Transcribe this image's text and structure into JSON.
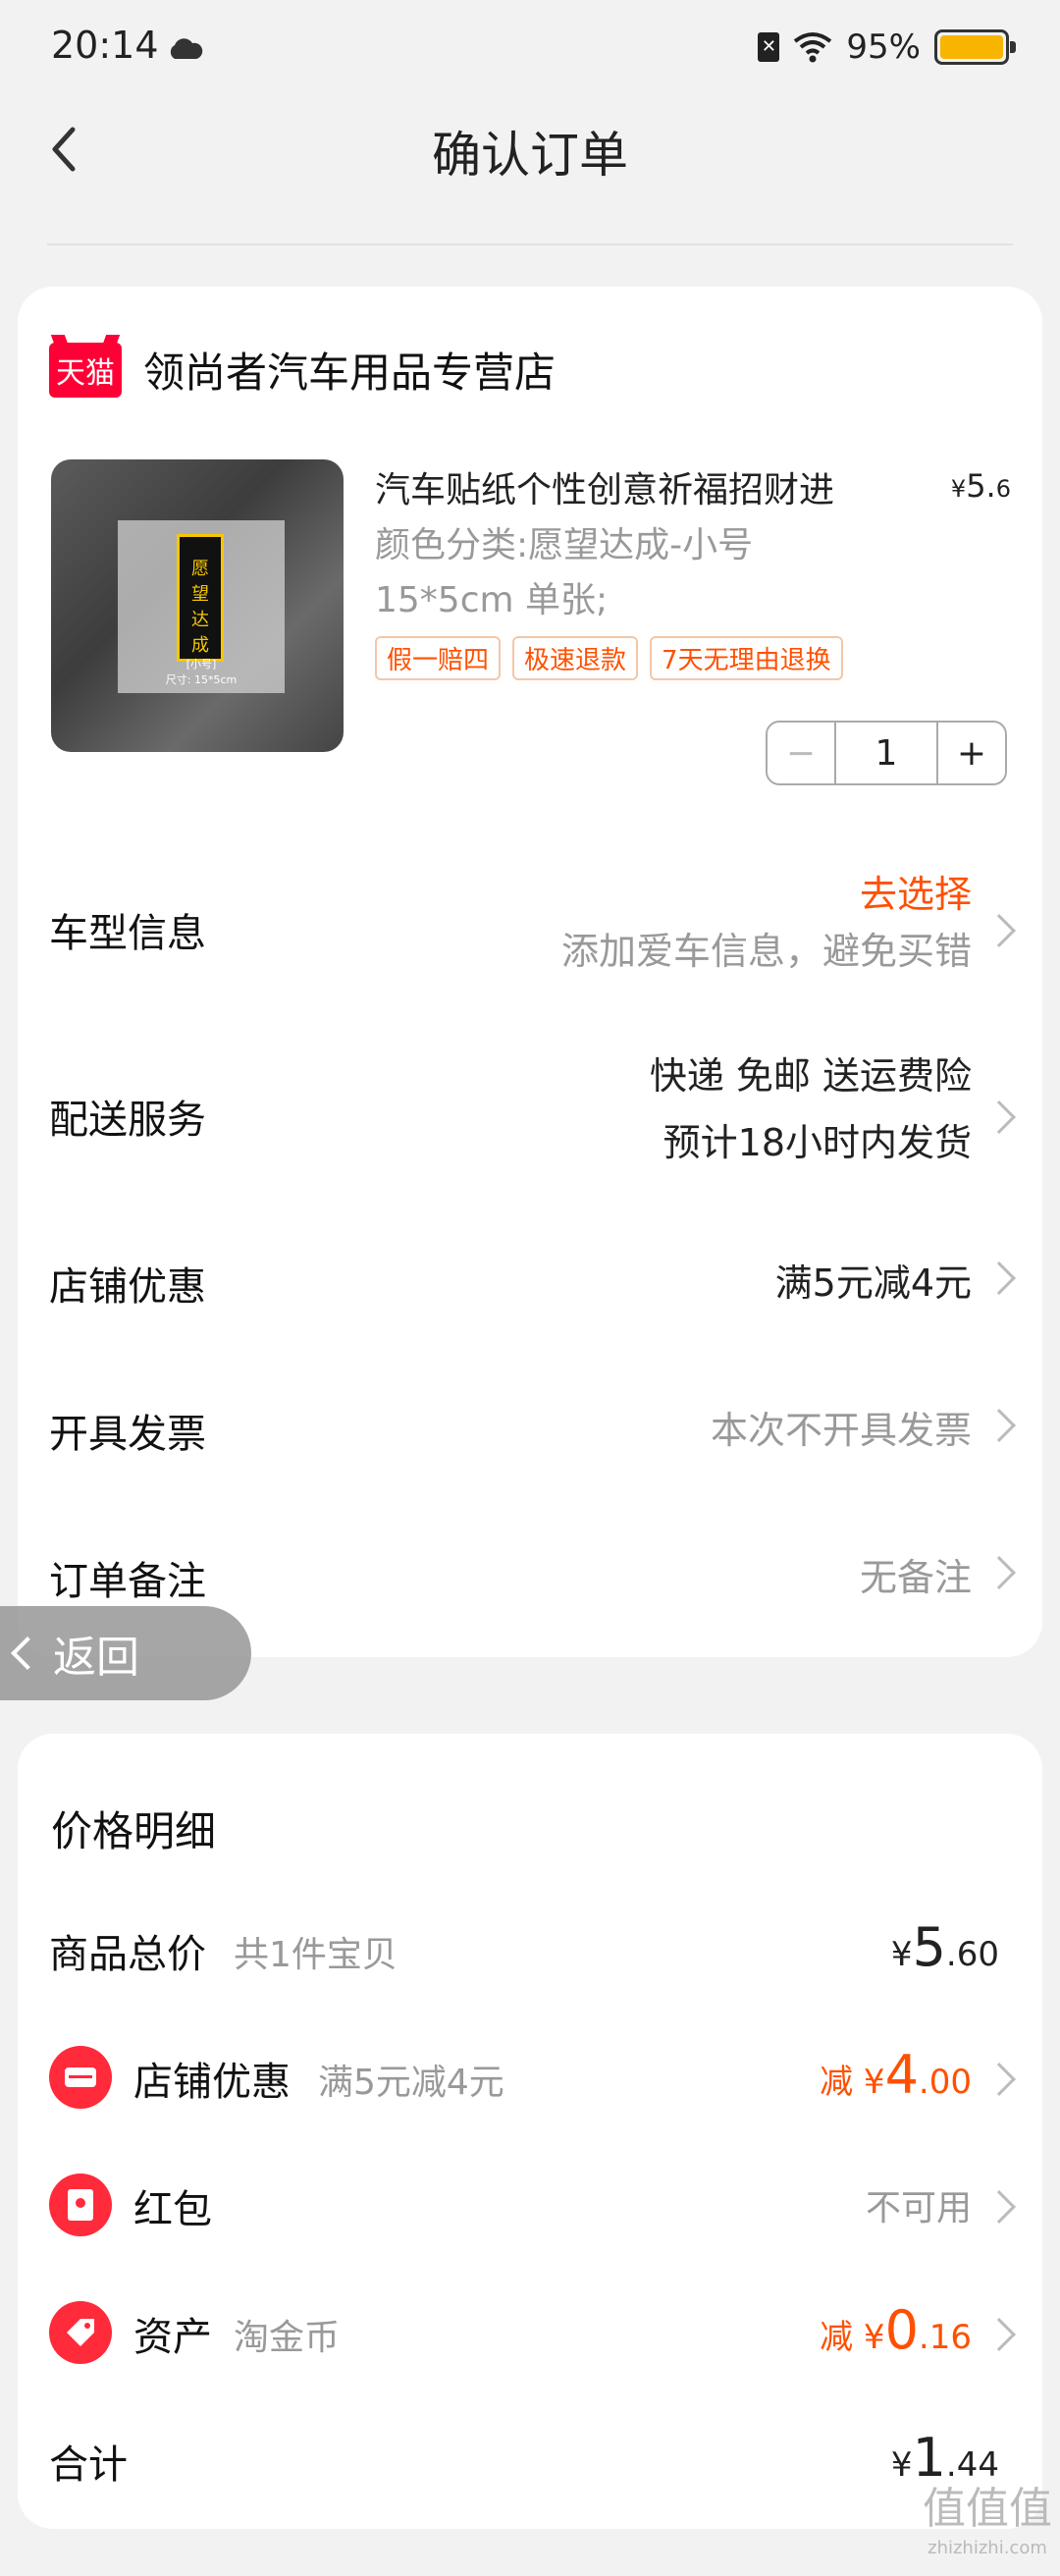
{
  "status_bar": {
    "time": "20:14",
    "battery": "95%"
  },
  "nav": {
    "title": "确认订单"
  },
  "shop": {
    "logo_text": "天猫",
    "name": "领尚者汽车用品专营店"
  },
  "product": {
    "title": "汽车贴纸个性创意祈福招财进",
    "price_symbol": "¥",
    "price_int": "5.",
    "price_dec": "6",
    "spec_line1": "颜色分类:愿望达成-小号",
    "spec_line2": "15*5cm 单张;",
    "tags": [
      "假一赔四",
      "极速退款",
      "7天无理由退换"
    ],
    "quantity": "1",
    "image_text": {
      "sticker": "愿望达成 COME TURE",
      "caption_size": "[小号]",
      "caption_dim": "尺寸: 15*5cm"
    }
  },
  "rows": {
    "car": {
      "label": "车型信息",
      "action": "去选择",
      "hint": "添加爱车信息，避免买错"
    },
    "delivery": {
      "label": "配送服务",
      "line1": "快递 免邮 送运费险",
      "line2": "预计18小时内发货"
    },
    "shop_discount": {
      "label": "店铺优惠",
      "value": "满5元减4元"
    },
    "invoice": {
      "label": "开具发票",
      "value": "本次不开具发票"
    },
    "note": {
      "label": "订单备注",
      "value": "无备注"
    }
  },
  "float_back": {
    "label": "返回"
  },
  "price_detail": {
    "title": "价格明细",
    "goods_total": {
      "label": "商品总价",
      "sub": "共1件宝贝",
      "symbol": "¥",
      "int": "5",
      "dec": ".60"
    },
    "shop_discount": {
      "label": "店铺优惠",
      "sub": "满5元减4元",
      "prefix": "减",
      "symbol": "¥",
      "int": "4",
      "dec": ".00"
    },
    "red_packet": {
      "label": "红包",
      "value": "不可用"
    },
    "assets": {
      "label": "资产",
      "sub": "淘金币",
      "prefix": "减",
      "symbol": "¥",
      "int": "0",
      "dec": ".16"
    },
    "total": {
      "label": "合计",
      "symbol": "¥",
      "int": "1",
      "dec": ".44"
    }
  },
  "watermark": {
    "main": "值值值",
    "sub": "zhizhizhi.com"
  },
  "colors": {
    "accent": "#ff5000",
    "tmall_red": "#ff0036",
    "battery": "#f7b500"
  }
}
